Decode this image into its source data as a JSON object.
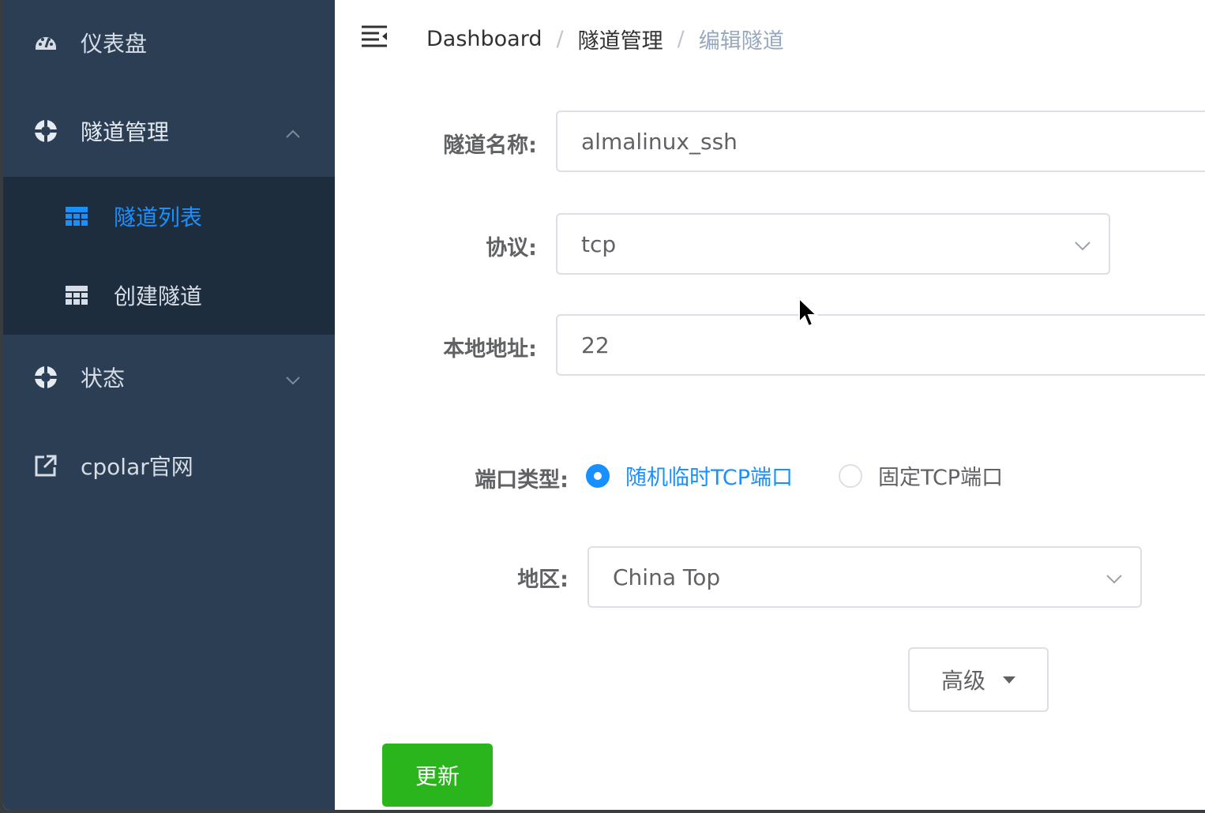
{
  "sidebar": {
    "dashboard": {
      "label": "仪表盘",
      "icon": "dashboard-icon"
    },
    "tunnel_management": {
      "label": "隧道管理",
      "icon": "life-ring-icon",
      "expanded": true
    },
    "tunnel_list": {
      "label": "隧道列表",
      "icon": "table-icon",
      "active": true
    },
    "create_tunnel": {
      "label": "创建隧道",
      "icon": "table-icon"
    },
    "status": {
      "label": "状态",
      "icon": "life-ring-icon",
      "expanded": false
    },
    "official_site": {
      "label": "cpolar官网",
      "icon": "external-link-icon"
    }
  },
  "header": {
    "breadcrumb": [
      "Dashboard",
      "隧道管理",
      "编辑隧道"
    ],
    "separator": "/"
  },
  "form": {
    "name_label": "隧道名称:",
    "name_value": "almalinux_ssh",
    "protocol_label": "协议:",
    "protocol_value": "tcp",
    "local_addr_label": "本地地址:",
    "local_addr_value": "22",
    "port_type_label": "端口类型:",
    "port_type_options": [
      "随机临时TCP端口",
      "固定TCP端口"
    ],
    "port_type_selected": "随机临时TCP端口",
    "region_label": "地区:",
    "region_value": "China Top",
    "advanced_label": "高级",
    "update_label": "更新"
  },
  "colors": {
    "sidebar_bg": "#2b3e54",
    "submenu_bg": "#1e2d3d",
    "accent": "#1890ff",
    "update_button": "#2bb51c"
  }
}
